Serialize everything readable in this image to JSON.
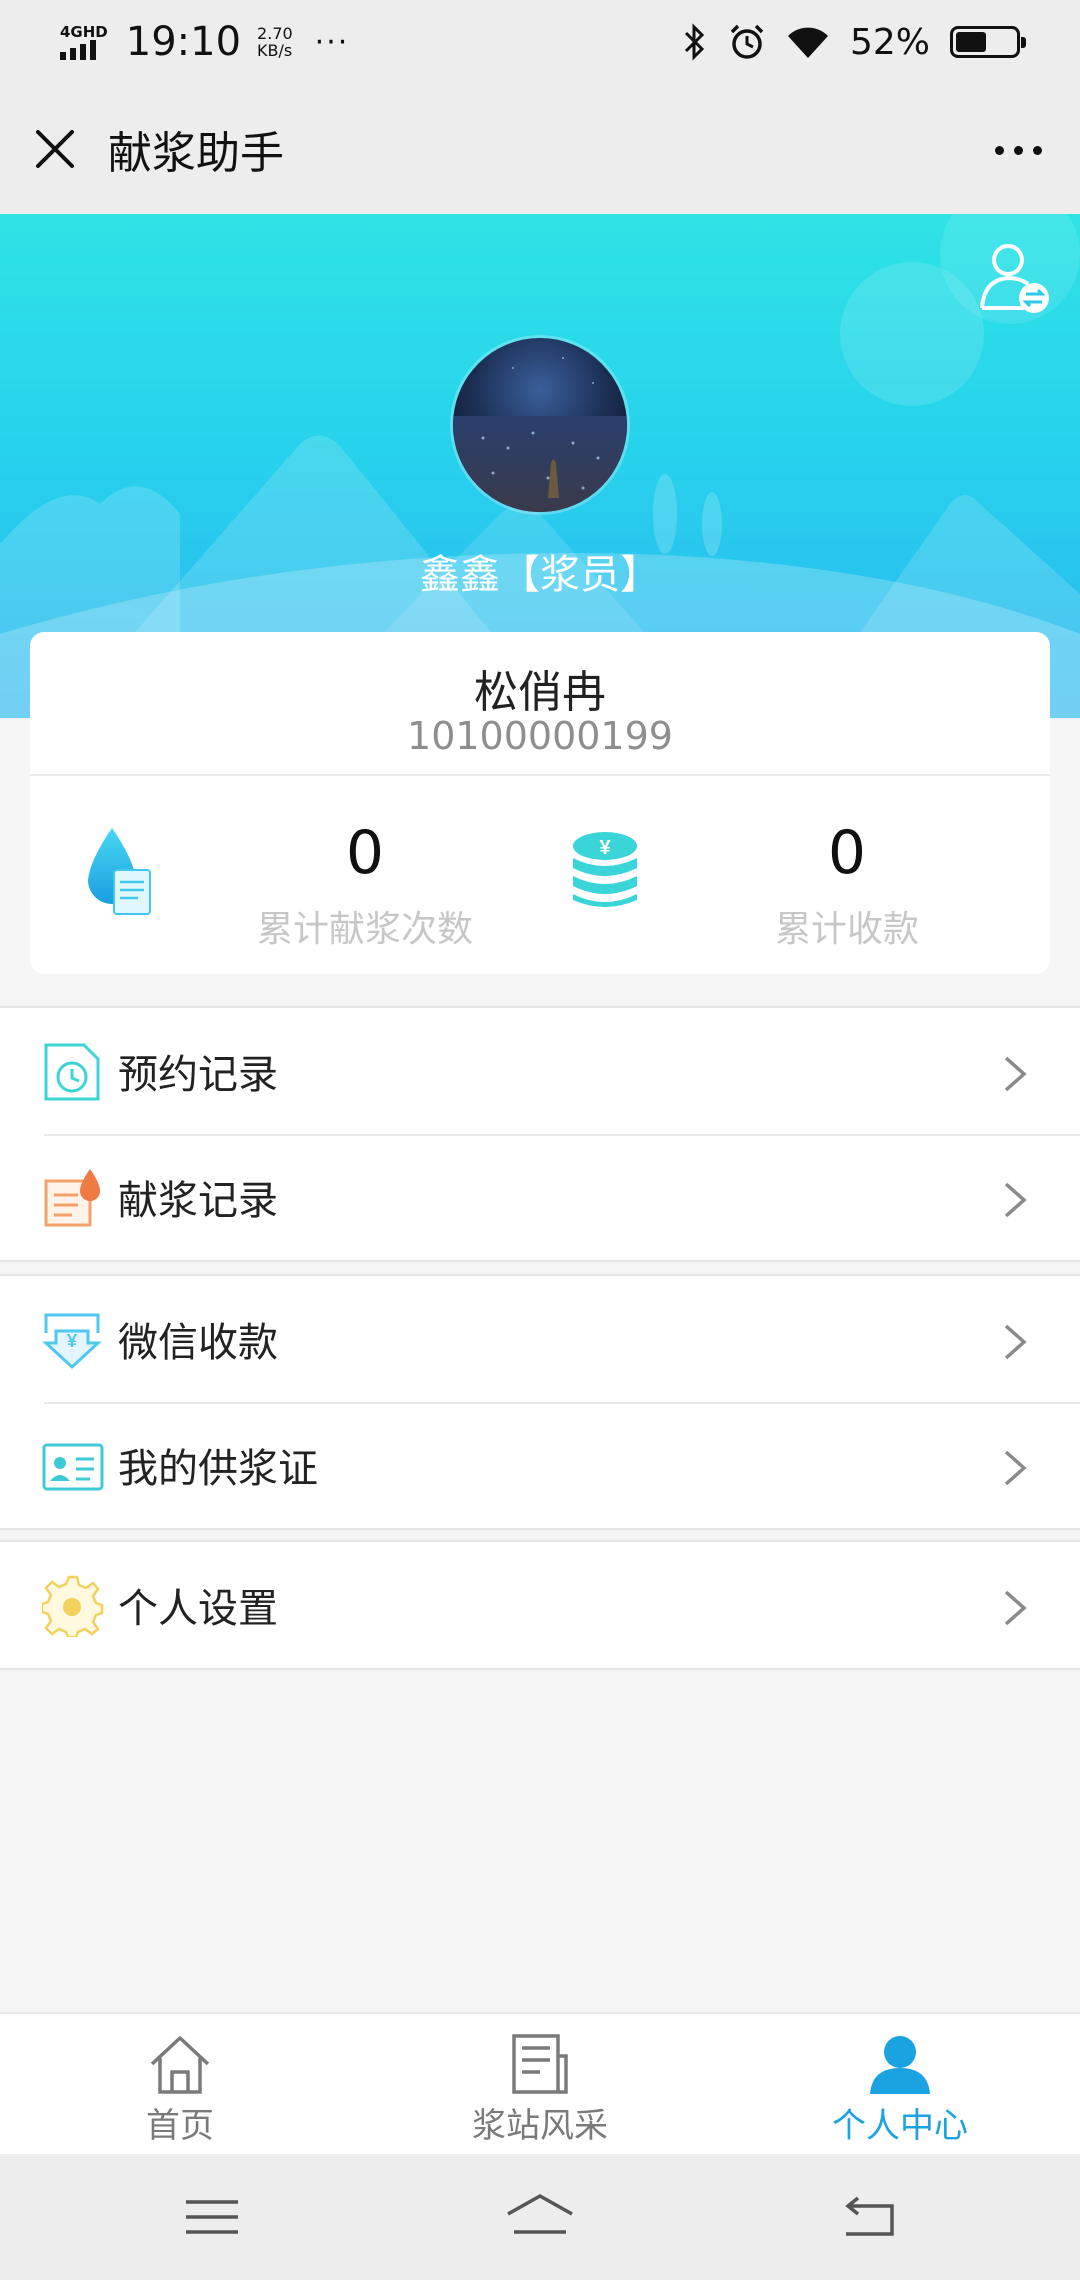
{
  "status_bar": {
    "network": "4GHD",
    "time": "19:10",
    "speed_value": "2.70",
    "speed_unit": "KB/s",
    "dots": "···",
    "battery_pct": "52%",
    "battery_level": 0.52
  },
  "title_bar": {
    "title": "献浆助手"
  },
  "profile": {
    "nickname": "鑫鑫",
    "role": "【浆员】",
    "name": "松俏冉",
    "id": "10100000199"
  },
  "stats": [
    {
      "value": "0",
      "label": "累计献浆次数",
      "icon": "plasma-drop-doc-icon"
    },
    {
      "value": "0",
      "label": "累计收款",
      "icon": "coin-stack-icon"
    }
  ],
  "menu": {
    "group1": [
      {
        "label": "预约记录",
        "icon": "appointment-clock-icon"
      },
      {
        "label": "献浆记录",
        "icon": "donation-record-icon"
      }
    ],
    "group2": [
      {
        "label": "微信收款",
        "icon": "yuan-receive-icon"
      },
      {
        "label": "我的供浆证",
        "icon": "id-card-icon"
      }
    ],
    "group3": [
      {
        "label": "个人设置",
        "icon": "gear-icon"
      }
    ]
  },
  "bottom_nav": [
    {
      "label": "首页",
      "icon": "home-icon",
      "active": false
    },
    {
      "label": "浆站风采",
      "icon": "news-icon",
      "active": false
    },
    {
      "label": "个人中心",
      "icon": "user-icon",
      "active": true
    }
  ],
  "colors": {
    "accent": "#1aa3e0",
    "hero_top": "#2ee3e6",
    "hero_bottom": "#2ab6f0"
  }
}
